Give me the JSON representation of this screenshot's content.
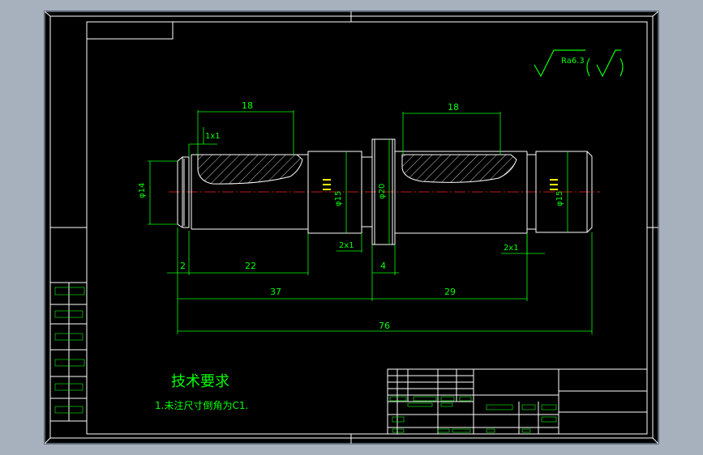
{
  "roughness": {
    "label": "Ra6.3",
    "symbol": "(√)"
  },
  "dimensions": {
    "len_left_groove": "18",
    "len_right_groove": "18",
    "chamfer_note": "1x1",
    "dia_left": "φ14",
    "dia_mid": "φ20",
    "dia_right": "φ15",
    "dia_shoulder": "φ15",
    "step_2x1_left": "2x1",
    "step_2x1_right": "2x1",
    "len_2": "2",
    "len_22": "22",
    "len_4": "4",
    "len_37": "37",
    "len_29": "29",
    "len_76": "76"
  },
  "tech_requirements": {
    "title": "技术要求",
    "item_1": "1.未注尺寸倒角为C1."
  },
  "colors": {
    "frame": "#ffffff",
    "dimension": "#00ff00",
    "centerline": "#ff2020",
    "tolerance": "#ffff00",
    "background": "#000000"
  }
}
